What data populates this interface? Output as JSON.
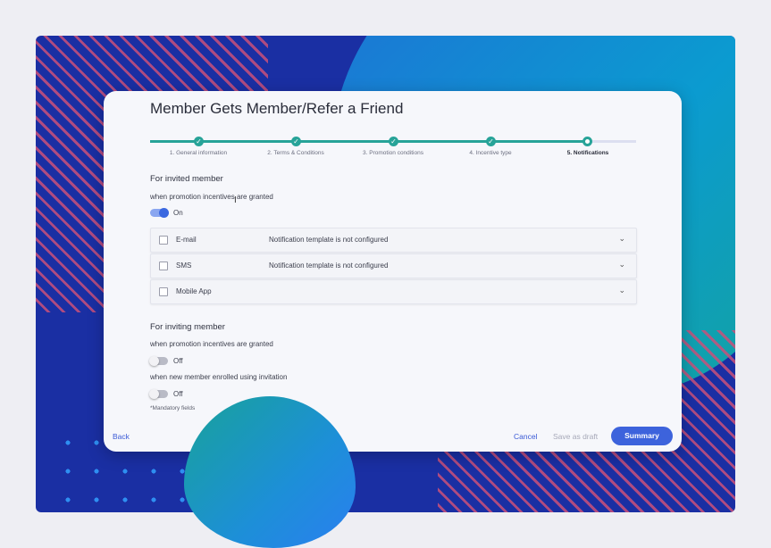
{
  "page": {
    "title": "Member Gets Member/Refer a Friend",
    "colors": {
      "accent": "#3d63dc",
      "progress": "#27a398",
      "background": "#1a2fa3"
    }
  },
  "stepper": {
    "steps": [
      {
        "label": "1. General information",
        "state": "done"
      },
      {
        "label": "2. Terms & Conditions",
        "state": "done"
      },
      {
        "label": "3. Promotion conditions",
        "state": "done"
      },
      {
        "label": "4. Incentive type",
        "state": "done"
      },
      {
        "label": "5. Notifications",
        "state": "current"
      }
    ],
    "check_icon": "check-icon"
  },
  "invited": {
    "title": "For invited member",
    "trigger": "when promotion incentives are granted",
    "toggle_label": "On",
    "toggle_on": true,
    "channels": [
      {
        "name": "E-mail",
        "status": "Notification template is not configured"
      },
      {
        "name": "SMS",
        "status": "Notification template is not configured"
      },
      {
        "name": "Mobile App",
        "status": ""
      }
    ]
  },
  "inviting": {
    "title": "For inviting member",
    "trigger1": "when promotion incentives are granted",
    "toggle1_label": "Off",
    "toggle1_on": false,
    "trigger2": "when new member enrolled using invitation",
    "toggle2_label": "Off",
    "toggle2_on": false
  },
  "mandatory_note": "*Mandatory fields",
  "footer": {
    "back": "Back",
    "cancel": "Cancel",
    "save_draft": "Save as draft",
    "summary": "Summary"
  }
}
